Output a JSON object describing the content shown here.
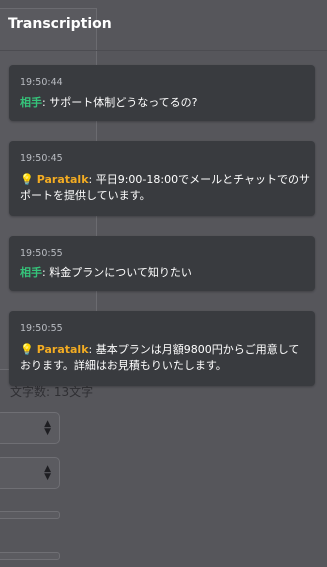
{
  "header": {
    "title": "Transcription"
  },
  "messages": [
    {
      "time": "19:50:44",
      "speaker": "相手",
      "role": "user",
      "text": "サポート体制どうなってるの?"
    },
    {
      "time": "19:50:45",
      "speaker": "Paratalk",
      "role": "bot",
      "icon": "lightbulb-icon",
      "text": "平日9:00-18:00でメールとチャットでのサポートを提供しています。"
    },
    {
      "time": "19:50:55",
      "speaker": "相手",
      "role": "user",
      "text": "料金プランについて知りたい"
    },
    {
      "time": "19:50:55",
      "speaker": "Paratalk",
      "role": "bot",
      "icon": "lightbulb-icon",
      "text": "基本プランは月額9800円からご用意しております。詳細はお見積もりいたします。"
    }
  ],
  "background": {
    "char_count": "文字数: 13文字"
  },
  "colors": {
    "user_speaker": "#35c47a",
    "bot_speaker": "#f3ac22",
    "card": "#393b3f",
    "overlay": "#56565b"
  }
}
